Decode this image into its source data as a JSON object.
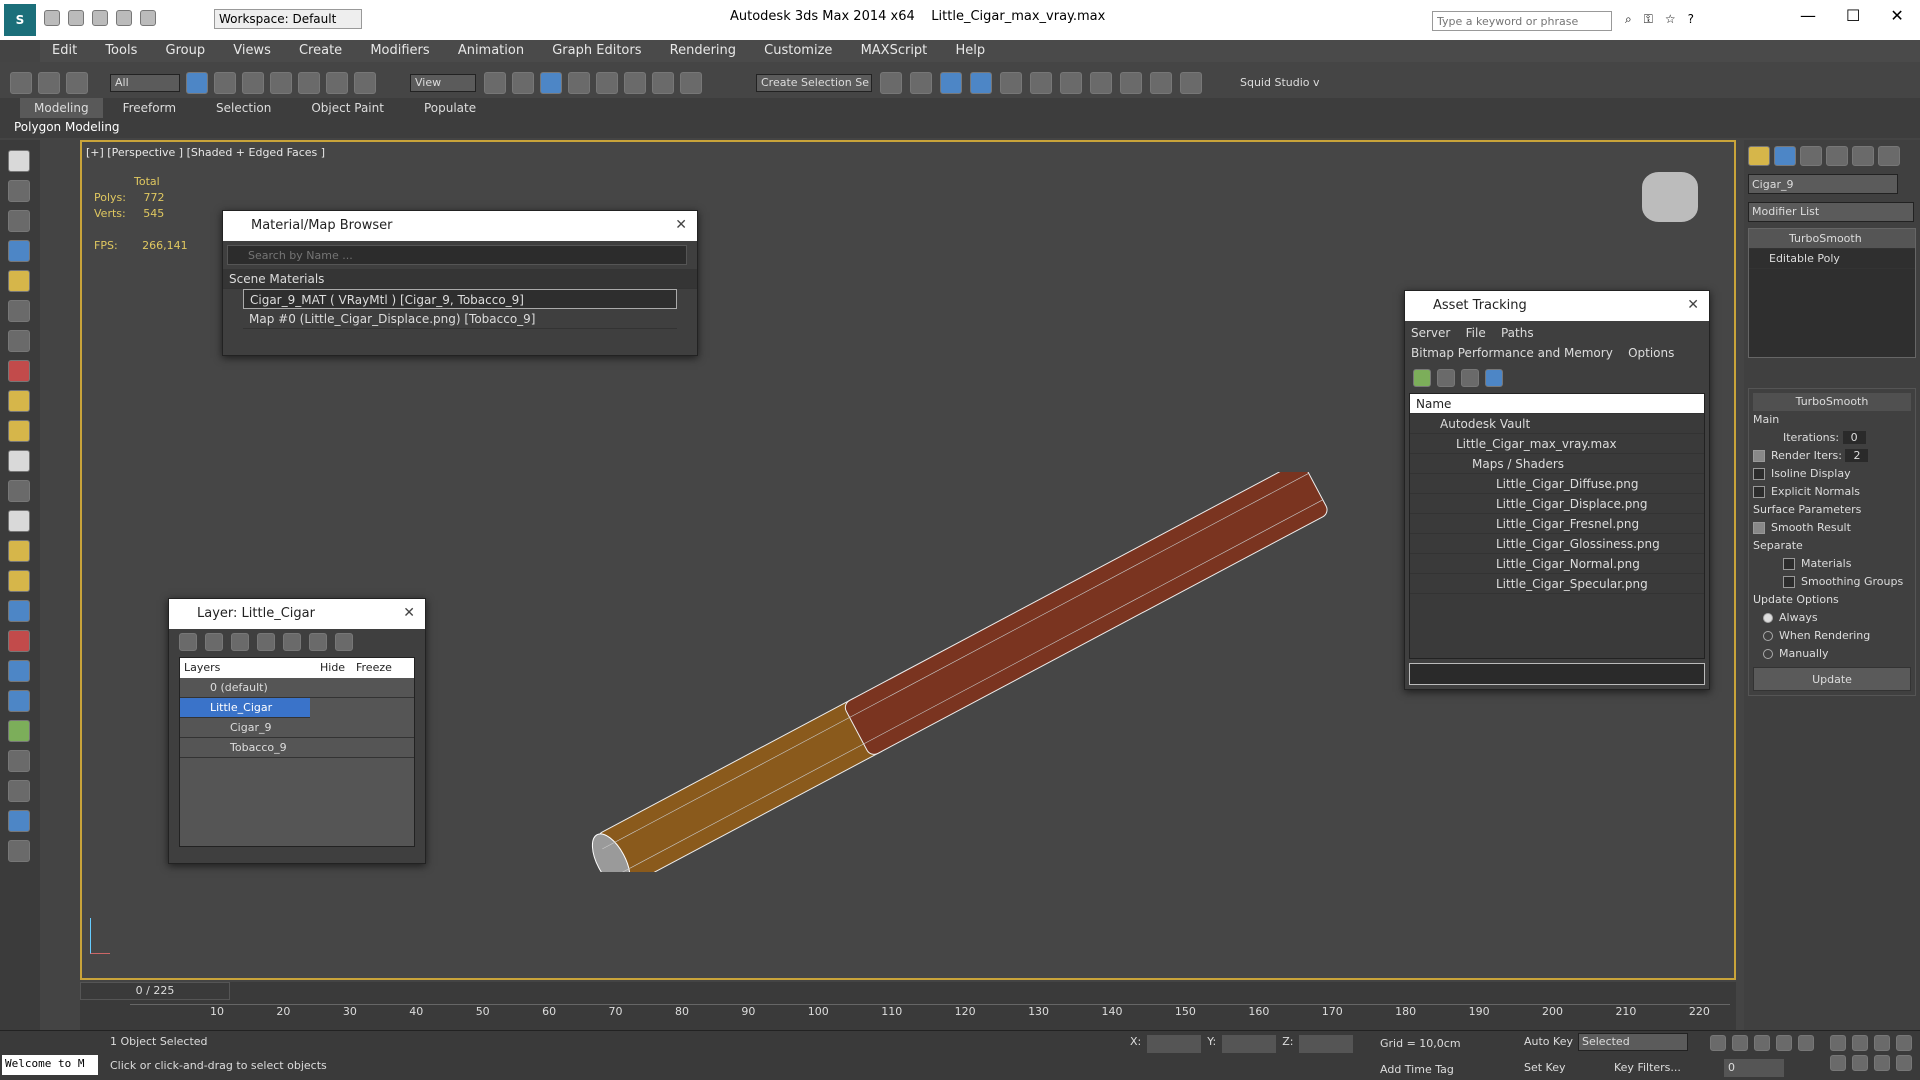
{
  "titlebar": {
    "app": "Autodesk 3ds Max  2014 x64",
    "file": "Little_Cigar_max_vray.max",
    "workspace": "Workspace: Default",
    "search_placeholder": "Type a keyword or phrase"
  },
  "menu": [
    "Edit",
    "Tools",
    "Group",
    "Views",
    "Create",
    "Modifiers",
    "Animation",
    "Graph Editors",
    "Rendering",
    "Customize",
    "MAXScript",
    "Help"
  ],
  "toolbar": {
    "filter": "All",
    "ref_coord": "View",
    "selset": "Create Selection Se",
    "plugin": "Squid Studio v"
  },
  "ribbon": {
    "tabs": [
      "Modeling",
      "Freeform",
      "Selection",
      "Object Paint",
      "Populate"
    ],
    "sub": "Polygon Modeling"
  },
  "viewport": {
    "label": "[+] [Perspective ] [Shaded + Edged Faces ]",
    "stats": {
      "total_label": "Total",
      "polys_label": "Polys:",
      "polys": "772",
      "verts_label": "Verts:",
      "verts": "545",
      "fps_label": "FPS:",
      "fps": "266,141"
    }
  },
  "material_browser": {
    "title": "Material/Map Browser",
    "search_placeholder": "Search by Name ...",
    "section": "Scene Materials",
    "items": [
      "Cigar_9_MAT ( VRayMtl ) [Cigar_9, Tobacco_9]",
      "Map #0 (Little_Cigar_Displace.png) [Tobacco_9]"
    ]
  },
  "layer_dialog": {
    "title": "Layer: Little_Cigar",
    "cols": [
      "Layers",
      "Hide",
      "Freeze"
    ],
    "rows": [
      "0 (default)",
      "Little_Cigar",
      "Cigar_9",
      "Tobacco_9"
    ]
  },
  "asset_tracking": {
    "title": "Asset Tracking",
    "menu": [
      "Server",
      "File",
      "Paths"
    ],
    "menu2": [
      "Bitmap Performance and Memory",
      "Options"
    ],
    "col": "Name",
    "rows": [
      "Autodesk Vault",
      "Little_Cigar_max_vray.max",
      "Maps / Shaders",
      "Little_Cigar_Diffuse.png",
      "Little_Cigar_Displace.png",
      "Little_Cigar_Fresnel.png",
      "Little_Cigar_Glossiness.png",
      "Little_Cigar_Normal.png",
      "Little_Cigar_Specular.png"
    ]
  },
  "command_panel": {
    "object_name": "Cigar_9",
    "modifier_list": "Modifier List",
    "stack": [
      "TurboSmooth",
      "Editable Poly"
    ],
    "rollout": "TurboSmooth",
    "main": "Main",
    "iterations_label": "Iterations:",
    "iterations": "0",
    "render_iters_label": "Render Iters:",
    "render_iters": "2",
    "isoline": "Isoline Display",
    "explicit": "Explicit Normals",
    "surface": "Surface Parameters",
    "smooth": "Smooth Result",
    "separate": "Separate",
    "materials": "Materials",
    "smoothing": "Smoothing Groups",
    "update_opts": "Update Options",
    "always": "Always",
    "when_rendering": "When Rendering",
    "manually": "Manually",
    "update_btn": "Update"
  },
  "timeline": {
    "frame": "0 / 225",
    "ticks": [
      "10",
      "20",
      "30",
      "40",
      "50",
      "60",
      "70",
      "80",
      "90",
      "100",
      "110",
      "120",
      "130",
      "140",
      "150",
      "160",
      "170",
      "180",
      "190",
      "200",
      "210",
      "220"
    ]
  },
  "status": {
    "welcome": "Welcome to M",
    "selected": "1 Object Selected",
    "prompt": "Click or click-and-drag to select objects",
    "x_label": "X:",
    "y_label": "Y:",
    "z_label": "Z:",
    "grid": "Grid = 10,0cm",
    "add_tag": "Add Time Tag",
    "auto_key": "Auto Key",
    "set_key": "Set Key",
    "selected_dd": "Selected",
    "key_filters": "Key Filters...",
    "frame": "0"
  }
}
